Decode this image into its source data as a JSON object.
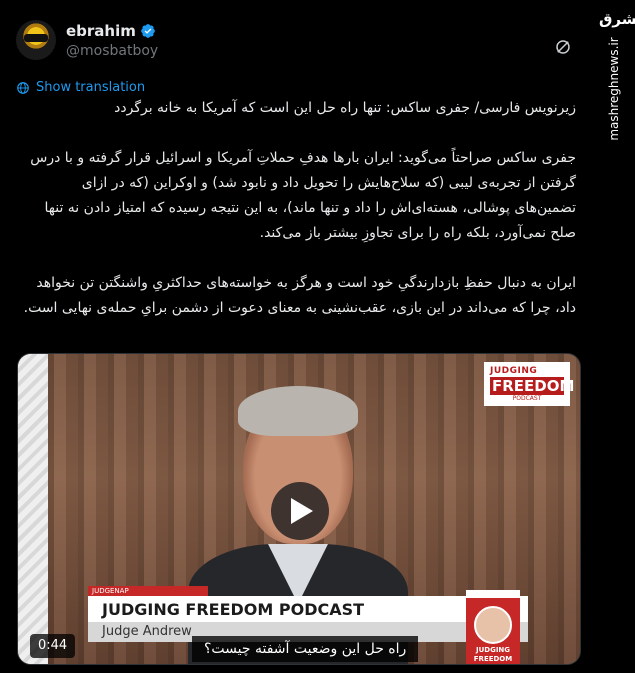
{
  "user": {
    "display_name": "ebrahim",
    "handle": "@mosbatboy",
    "verified": true
  },
  "actions": {
    "show_translation": "Show translation"
  },
  "tweet": {
    "paragraphs": [
      "زیرنویس فارسی/ جفری ساکس: تنها راه حل این است که آمریکا به خانه برگردد",
      "جفری ساکس صراحتاً می‌گوید: ایران بارها هدفِ حملاتِ آمریکا و اسرائیل قرار گرفته و با درس گرفتن از تجربه‌ی لیبی (که سلاح‌هایش را تحویل داد و نابود شد) و اوکراین (که در ازای تضمین‌های پوشالی، هسته‌ای‌اش را داد و تنها ماند)، به این نتیجه رسیده که امتیاز دادن نه تنها صلح نمی‌آورد، بلکه راه را برای تجاوزِ بیشتر باز می‌کند.",
      "ایران به دنبال حفظِ بازدارندگیِ خود است و هرگز به خواسته‌های حداکثریِ واشنگتن تن نخواهد داد، چرا که می‌داند در این بازی، عقب‌نشینی به معنای دعوت از دشمن برایِ حمله‌ی نهایی است."
    ]
  },
  "video": {
    "duration": "0:44",
    "logo_line1": "JUDGING",
    "logo_line2": "FREEDOM",
    "logo_line3": "PODCAST",
    "lower_third_tag": "JUDGENAP",
    "show_title": "JUDGING FREEDOM PODCAST",
    "host_name": "Judge Andrew",
    "badge_label": "JUDGING FREEDOM",
    "subtitle": "راه حل این وضعیت آشفته چیست؟"
  },
  "watermark": {
    "logo_text": "مشرق",
    "site_url": "mashreghnews.ir"
  },
  "icons": {
    "verified": "verified-badge-icon",
    "grok": "grok-icon",
    "globe": "globe-icon",
    "play": "play-icon"
  },
  "colors": {
    "background": "#000000",
    "text": "#e7e9ea",
    "muted": "#71767b",
    "link": "#1d9bf0",
    "verified": "#1d9bf0",
    "brand_red": "#c62828"
  }
}
